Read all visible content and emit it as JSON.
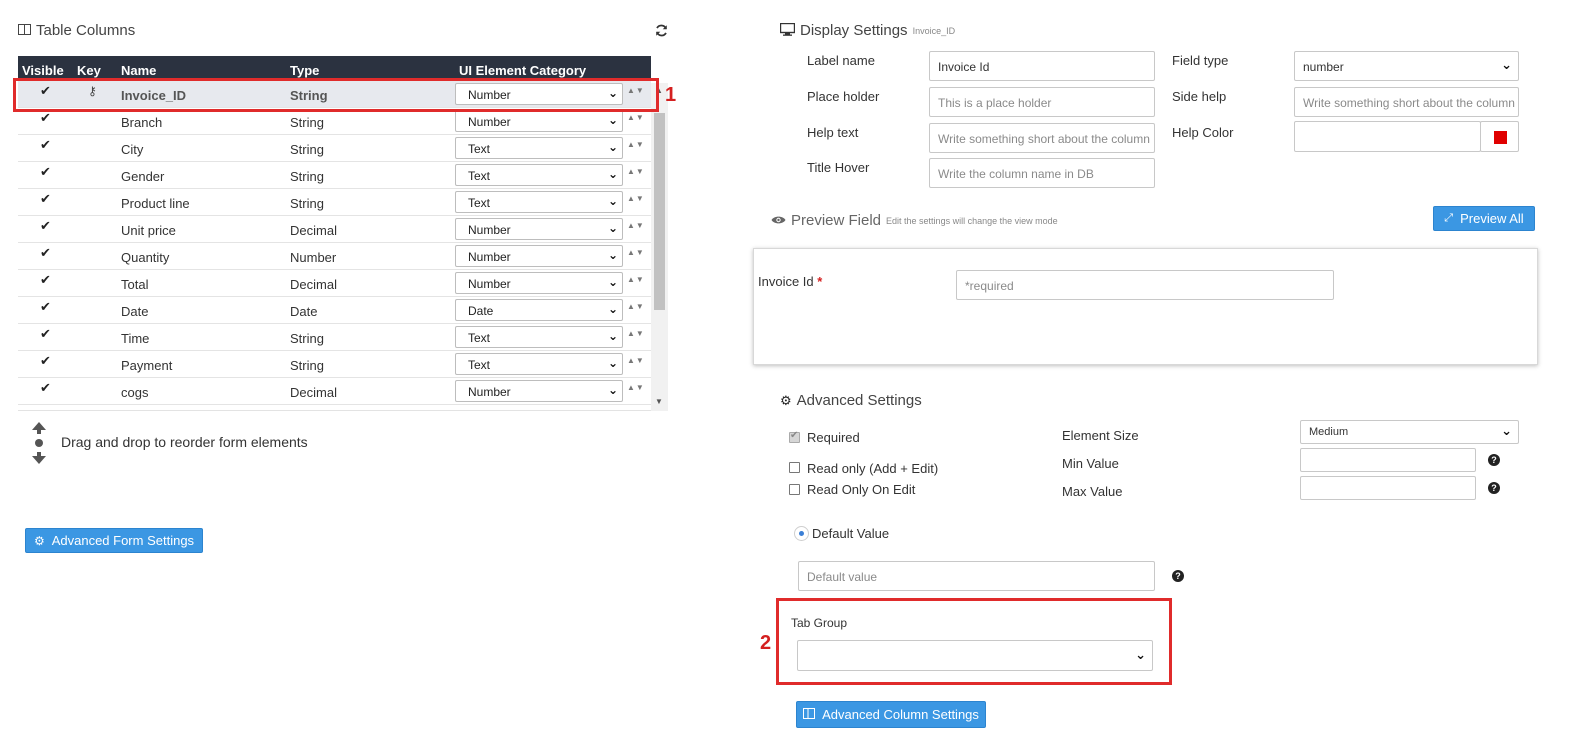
{
  "left": {
    "title": "Table Columns",
    "refresh_icon": "refresh-icon",
    "columns": [
      "Visible",
      "Key",
      "Name",
      "Type",
      "UI Element Category"
    ],
    "rows": [
      {
        "visible": "✔",
        "key": "⚷",
        "name": "Invoice_ID",
        "type": "String",
        "category": "Number",
        "selected": true
      },
      {
        "visible": "✔",
        "key": "",
        "name": "Branch",
        "type": "String",
        "category": "Number"
      },
      {
        "visible": "✔",
        "key": "",
        "name": "City",
        "type": "String",
        "category": "Text"
      },
      {
        "visible": "✔",
        "key": "",
        "name": "Gender",
        "type": "String",
        "category": "Text"
      },
      {
        "visible": "✔",
        "key": "",
        "name": "Product line",
        "type": "String",
        "category": "Text"
      },
      {
        "visible": "✔",
        "key": "",
        "name": "Unit price",
        "type": "Decimal",
        "category": "Number"
      },
      {
        "visible": "✔",
        "key": "",
        "name": "Quantity",
        "type": "Number",
        "category": "Number"
      },
      {
        "visible": "✔",
        "key": "",
        "name": "Total",
        "type": "Decimal",
        "category": "Number"
      },
      {
        "visible": "✔",
        "key": "",
        "name": "Date",
        "type": "Date",
        "category": "Date"
      },
      {
        "visible": "✔",
        "key": "",
        "name": "Time",
        "type": "String",
        "category": "Text"
      },
      {
        "visible": "✔",
        "key": "",
        "name": "Payment",
        "type": "String",
        "category": "Text"
      },
      {
        "visible": "✔",
        "key": "",
        "name": "cogs",
        "type": "Decimal",
        "category": "Number"
      }
    ],
    "drag_hint": "Drag and drop to reorder form elements",
    "advanced_form_button": "Advanced Form Settings"
  },
  "annotations": {
    "one": "1",
    "two": "2"
  },
  "display": {
    "title": "Display Settings",
    "subtitle": "Invoice_ID",
    "label_name_label": "Label name",
    "label_name_value": "Invoice Id",
    "field_type_label": "Field type",
    "field_type_value": "number",
    "placeholder_label": "Place holder",
    "placeholder_value": "This is a place holder",
    "side_help_label": "Side help",
    "side_help_placeholder": "Write something short about the column",
    "help_text_label": "Help text",
    "help_text_placeholder": "Write something short about the column",
    "help_color_label": "Help Color",
    "help_color_swatch": "#e00000",
    "title_hover_label": "Title Hover",
    "title_hover_placeholder": "Write the column name in DB"
  },
  "preview": {
    "title": "Preview Field",
    "subtitle": "Edit the settings will change the view mode",
    "preview_all_button": "Preview All",
    "field_label": "Invoice Id",
    "required_star": "*",
    "field_placeholder": "*required"
  },
  "advanced": {
    "title": "Advanced Settings",
    "required_label": "Required",
    "read_only_label": "Read only (Add + Edit)",
    "read_only_edit_label": "Read Only On Edit",
    "element_size_label": "Element Size",
    "element_size_value": "Medium",
    "min_value_label": "Min Value",
    "max_value_label": "Max Value",
    "default_value_label": "Default Value",
    "default_value_placeholder": "Default value",
    "tab_group_label": "Tab Group",
    "tab_group_value": "",
    "advanced_column_button": "Advanced Column Settings"
  },
  "colors": {
    "accent": "#3b97e3",
    "header_bg": "#2b3240",
    "highlight": "#e02b2b"
  }
}
